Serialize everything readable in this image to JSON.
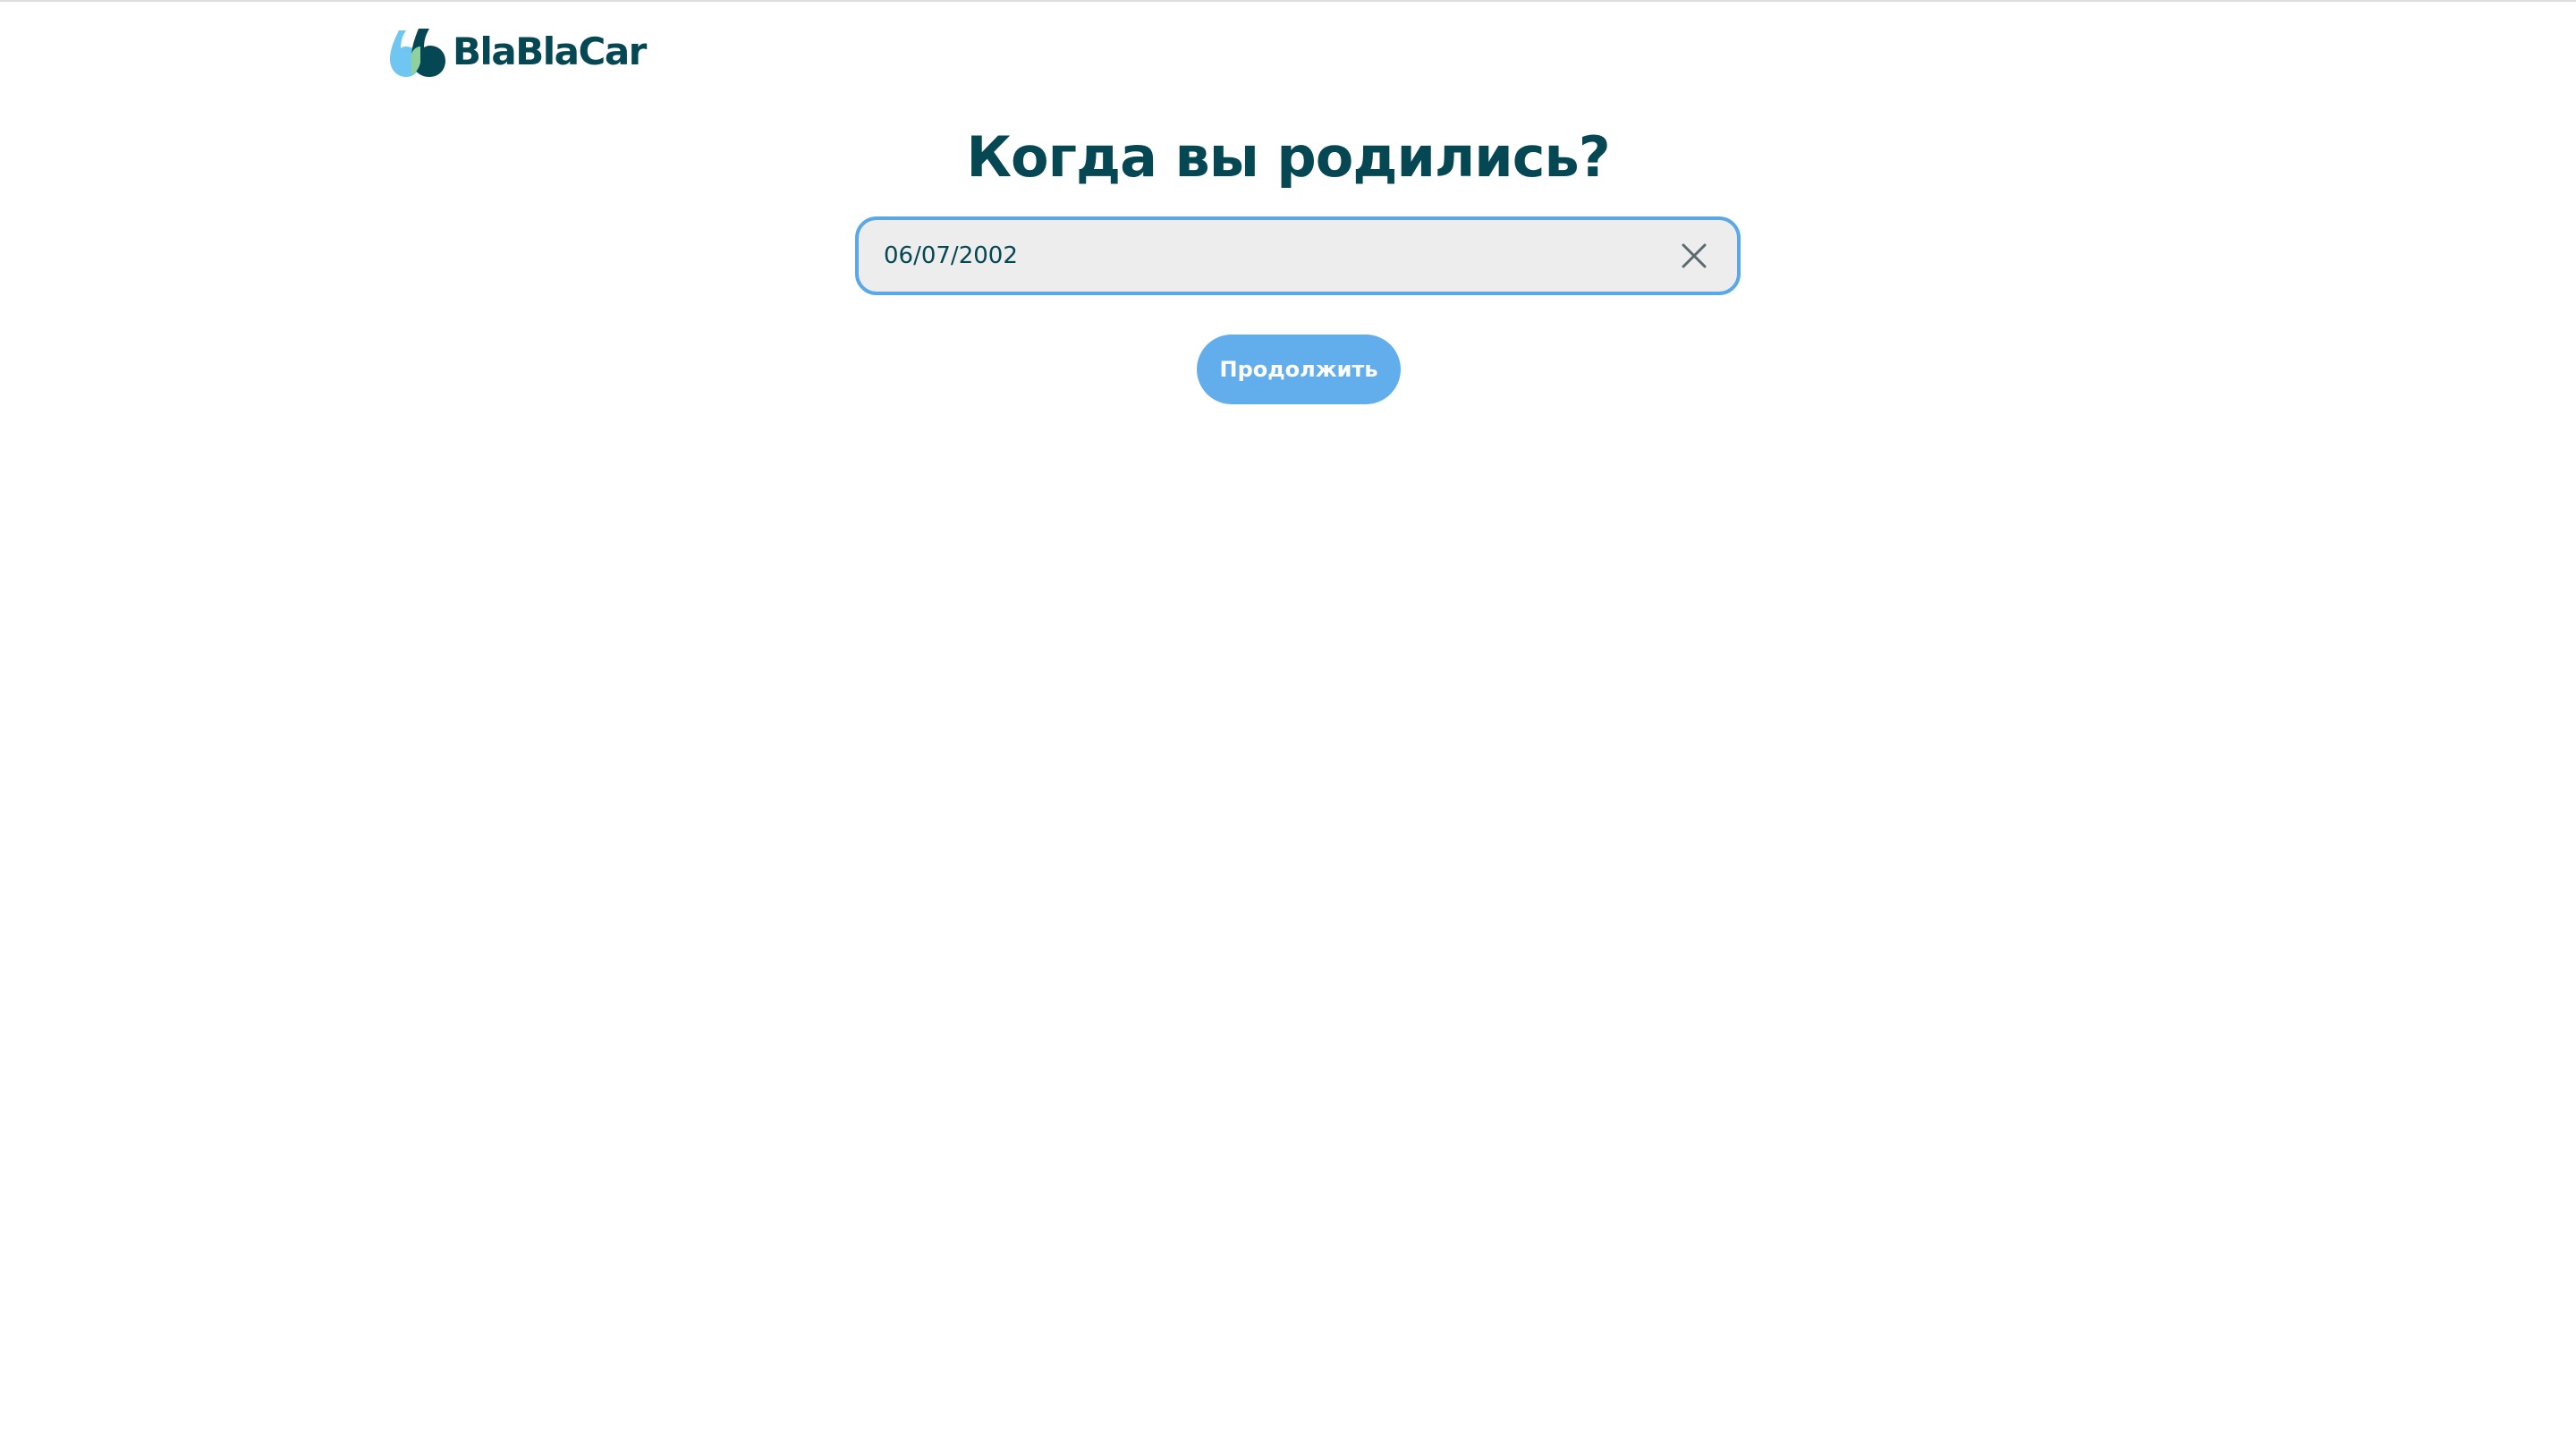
{
  "header": {
    "logo_text": "BlaBlaCar"
  },
  "main": {
    "title": "Когда вы родились?",
    "birthdate_value": "06/07/2002",
    "continue_label": "Продолжить"
  },
  "icons": {
    "logo": "blablacar-logo-icon",
    "clear": "close-icon"
  },
  "colors": {
    "brand_dark": "#054752",
    "brand_light": "#6ec6f1",
    "focus_border": "#5aa9e6",
    "button_bg": "#62aeec",
    "field_bg": "#ededed"
  }
}
